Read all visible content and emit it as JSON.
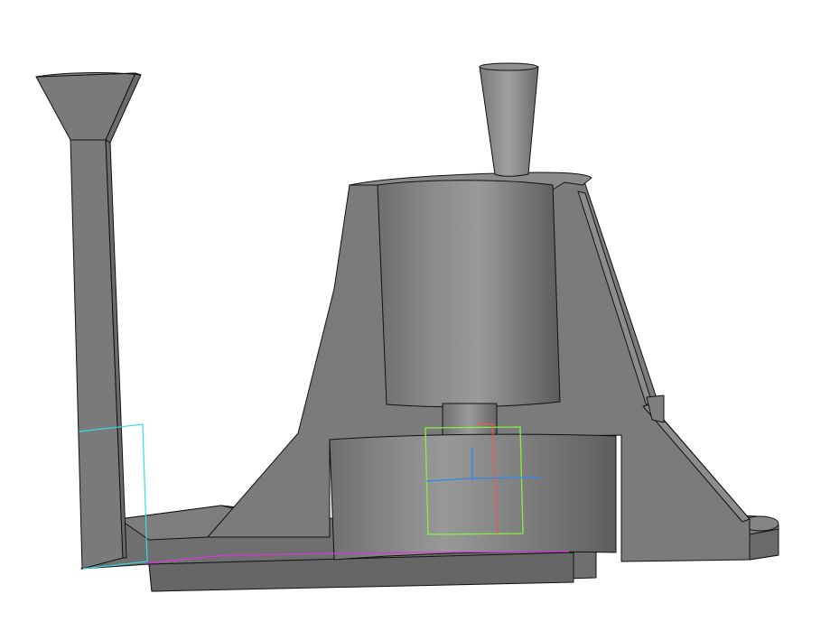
{
  "viewer": {
    "title": "",
    "background_color": "#ffffff",
    "model_color": "#7a7a7a"
  },
  "sketch_colors": {
    "cyan": "#33dde8",
    "magenta": "#dd33dd",
    "green": "#88ee44",
    "red": "#ee5555",
    "blue": "#3388ee"
  },
  "model": {
    "parts": [
      "sprue-funnel",
      "sprue-channel",
      "base-plate",
      "conical-housing",
      "cylinder-core",
      "top-cone-riser",
      "connector-shaft",
      "lower-block",
      "side-rib",
      "right-foot"
    ]
  }
}
